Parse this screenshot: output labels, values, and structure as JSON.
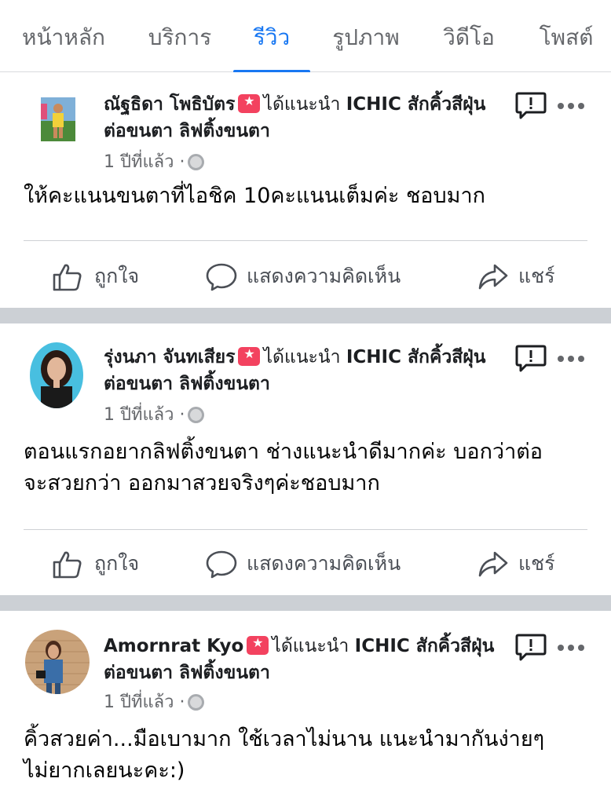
{
  "tabs": [
    {
      "label": "หน้าหลัก",
      "active": false
    },
    {
      "label": "บริการ",
      "active": false
    },
    {
      "label": "รีวิว",
      "active": true
    },
    {
      "label": "รูปภาพ",
      "active": false
    },
    {
      "label": "วิดีโอ",
      "active": false
    },
    {
      "label": "โพสต์",
      "active": false
    }
  ],
  "colors": {
    "accent": "#1877f2",
    "recommend": "#f3425f",
    "divider": "#ccd0d5"
  },
  "actions": {
    "like": "ถูกใจ",
    "comment": "แสดงความคิดเห็น",
    "share": "แชร์"
  },
  "posts": [
    {
      "author": "ณัฐธิดา โพธิบัตร",
      "recommend_verb": "ได้แนะนำ",
      "page": "ICHIC สักคิ้วสีฝุ่น ต่อขนตา ลิฟติ้งขนตา",
      "time": "1 ปีที่แล้ว ·",
      "text": "ให้คะแนนขนตาที่ไอชิค 10คะแนนเต็มค่ะ ชอบมาก"
    },
    {
      "author": "รุ่งนภา จันทเสียร",
      "recommend_verb": "ได้แนะนำ",
      "page": "ICHIC สักคิ้วสีฝุ่น ต่อขนตา ลิฟติ้งขนตา",
      "time": "1 ปีที่แล้ว ·",
      "text": "ตอนแรกอยากลิฟติ้งขนตา ช่างแนะนำดีมากค่ะ บอกว่าต่อจะสวยกว่า ออกมาสวยจริงๆค่ะชอบมาก"
    },
    {
      "author": "Amornrat Kyo",
      "recommend_verb": "ได้แนะนำ",
      "page": "ICHIC สักคิ้วสีฝุ่น ต่อขนตา ลิฟติ้งขนตา",
      "time": "1 ปีที่แล้ว ·",
      "text": "คิ้วสวยค่า...มือเบามาก ใช้เวลาไม่นาน แนะนำมากันง่ายๆไม่ยากเลยนะคะ:)"
    }
  ]
}
